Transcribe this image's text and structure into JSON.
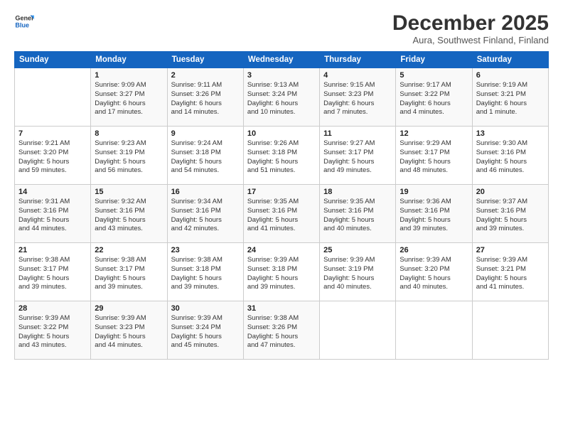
{
  "logo": {
    "line1": "General",
    "line2": "Blue"
  },
  "title": "December 2025",
  "subtitle": "Aura, Southwest Finland, Finland",
  "days_header": [
    "Sunday",
    "Monday",
    "Tuesday",
    "Wednesday",
    "Thursday",
    "Friday",
    "Saturday"
  ],
  "weeks": [
    [
      {
        "day": "",
        "info": ""
      },
      {
        "day": "1",
        "info": "Sunrise: 9:09 AM\nSunset: 3:27 PM\nDaylight: 6 hours\nand 17 minutes."
      },
      {
        "day": "2",
        "info": "Sunrise: 9:11 AM\nSunset: 3:26 PM\nDaylight: 6 hours\nand 14 minutes."
      },
      {
        "day": "3",
        "info": "Sunrise: 9:13 AM\nSunset: 3:24 PM\nDaylight: 6 hours\nand 10 minutes."
      },
      {
        "day": "4",
        "info": "Sunrise: 9:15 AM\nSunset: 3:23 PM\nDaylight: 6 hours\nand 7 minutes."
      },
      {
        "day": "5",
        "info": "Sunrise: 9:17 AM\nSunset: 3:22 PM\nDaylight: 6 hours\nand 4 minutes."
      },
      {
        "day": "6",
        "info": "Sunrise: 9:19 AM\nSunset: 3:21 PM\nDaylight: 6 hours\nand 1 minute."
      }
    ],
    [
      {
        "day": "7",
        "info": "Sunrise: 9:21 AM\nSunset: 3:20 PM\nDaylight: 5 hours\nand 59 minutes."
      },
      {
        "day": "8",
        "info": "Sunrise: 9:23 AM\nSunset: 3:19 PM\nDaylight: 5 hours\nand 56 minutes."
      },
      {
        "day": "9",
        "info": "Sunrise: 9:24 AM\nSunset: 3:18 PM\nDaylight: 5 hours\nand 54 minutes."
      },
      {
        "day": "10",
        "info": "Sunrise: 9:26 AM\nSunset: 3:18 PM\nDaylight: 5 hours\nand 51 minutes."
      },
      {
        "day": "11",
        "info": "Sunrise: 9:27 AM\nSunset: 3:17 PM\nDaylight: 5 hours\nand 49 minutes."
      },
      {
        "day": "12",
        "info": "Sunrise: 9:29 AM\nSunset: 3:17 PM\nDaylight: 5 hours\nand 48 minutes."
      },
      {
        "day": "13",
        "info": "Sunrise: 9:30 AM\nSunset: 3:16 PM\nDaylight: 5 hours\nand 46 minutes."
      }
    ],
    [
      {
        "day": "14",
        "info": "Sunrise: 9:31 AM\nSunset: 3:16 PM\nDaylight: 5 hours\nand 44 minutes."
      },
      {
        "day": "15",
        "info": "Sunrise: 9:32 AM\nSunset: 3:16 PM\nDaylight: 5 hours\nand 43 minutes."
      },
      {
        "day": "16",
        "info": "Sunrise: 9:34 AM\nSunset: 3:16 PM\nDaylight: 5 hours\nand 42 minutes."
      },
      {
        "day": "17",
        "info": "Sunrise: 9:35 AM\nSunset: 3:16 PM\nDaylight: 5 hours\nand 41 minutes."
      },
      {
        "day": "18",
        "info": "Sunrise: 9:35 AM\nSunset: 3:16 PM\nDaylight: 5 hours\nand 40 minutes."
      },
      {
        "day": "19",
        "info": "Sunrise: 9:36 AM\nSunset: 3:16 PM\nDaylight: 5 hours\nand 39 minutes."
      },
      {
        "day": "20",
        "info": "Sunrise: 9:37 AM\nSunset: 3:16 PM\nDaylight: 5 hours\nand 39 minutes."
      }
    ],
    [
      {
        "day": "21",
        "info": "Sunrise: 9:38 AM\nSunset: 3:17 PM\nDaylight: 5 hours\nand 39 minutes."
      },
      {
        "day": "22",
        "info": "Sunrise: 9:38 AM\nSunset: 3:17 PM\nDaylight: 5 hours\nand 39 minutes."
      },
      {
        "day": "23",
        "info": "Sunrise: 9:38 AM\nSunset: 3:18 PM\nDaylight: 5 hours\nand 39 minutes."
      },
      {
        "day": "24",
        "info": "Sunrise: 9:39 AM\nSunset: 3:18 PM\nDaylight: 5 hours\nand 39 minutes."
      },
      {
        "day": "25",
        "info": "Sunrise: 9:39 AM\nSunset: 3:19 PM\nDaylight: 5 hours\nand 40 minutes."
      },
      {
        "day": "26",
        "info": "Sunrise: 9:39 AM\nSunset: 3:20 PM\nDaylight: 5 hours\nand 40 minutes."
      },
      {
        "day": "27",
        "info": "Sunrise: 9:39 AM\nSunset: 3:21 PM\nDaylight: 5 hours\nand 41 minutes."
      }
    ],
    [
      {
        "day": "28",
        "info": "Sunrise: 9:39 AM\nSunset: 3:22 PM\nDaylight: 5 hours\nand 43 minutes."
      },
      {
        "day": "29",
        "info": "Sunrise: 9:39 AM\nSunset: 3:23 PM\nDaylight: 5 hours\nand 44 minutes."
      },
      {
        "day": "30",
        "info": "Sunrise: 9:39 AM\nSunset: 3:24 PM\nDaylight: 5 hours\nand 45 minutes."
      },
      {
        "day": "31",
        "info": "Sunrise: 9:38 AM\nSunset: 3:26 PM\nDaylight: 5 hours\nand 47 minutes."
      },
      {
        "day": "",
        "info": ""
      },
      {
        "day": "",
        "info": ""
      },
      {
        "day": "",
        "info": ""
      }
    ]
  ]
}
